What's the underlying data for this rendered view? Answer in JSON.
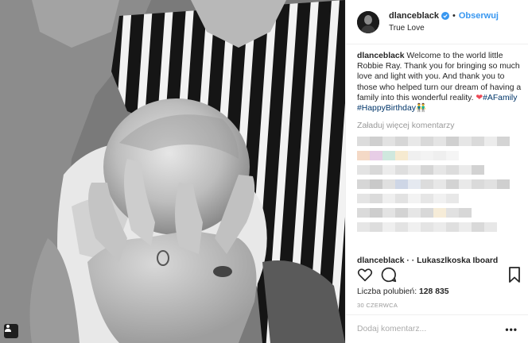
{
  "post": {
    "username": "dlanceblack",
    "separator": "•",
    "follow_label": "Obserwuj",
    "location": "True Love",
    "caption": {
      "username": "dlanceblack",
      "text": "Welcome to the world little Robbie Ray. Thank you for bringing so much love and light with you. And thank you to those who helped turn our dream of having a family into this wonderful reality.",
      "heart": "❤",
      "tag1": "#AFamily",
      "tag2": "#HappyBirthday",
      "emoji": "👬"
    },
    "load_more": "Załaduj więcej komentarzy",
    "partial_comment": "dlanceblack · · Lukaszlkoska Iboard",
    "likes_label": "Liczba polubień:",
    "likes_count": "128 835",
    "date": "30 CZERWCA",
    "comment_placeholder": "Dodaj komentarz...",
    "options_label": "•••"
  },
  "colors": {
    "link_blue": "#3897f0",
    "hashtag": "#003569",
    "heart": "#ed4956",
    "muted": "#999999"
  },
  "icons": {
    "verified": "verified-badge-icon",
    "like": "heart-outline-icon",
    "comment": "speech-bubble-icon",
    "save": "bookmark-icon",
    "tag_people": "person-tag-icon"
  }
}
